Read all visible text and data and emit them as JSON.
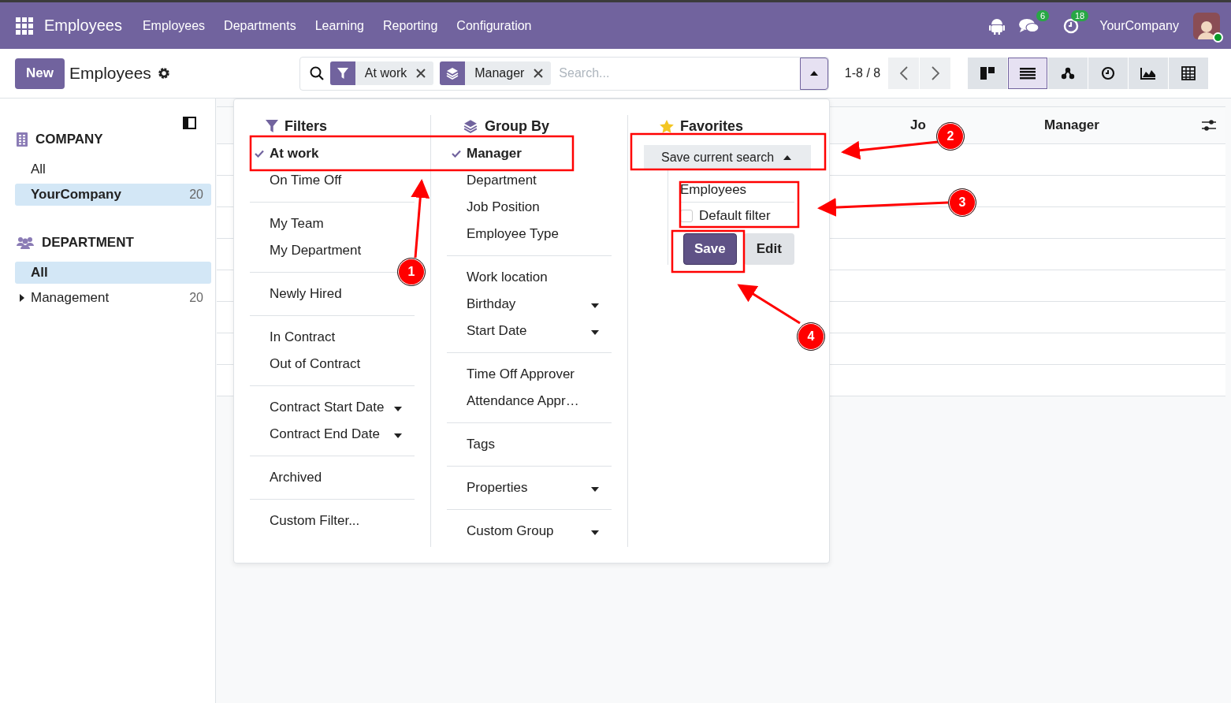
{
  "navbar": {
    "app_name": "Employees",
    "menu": [
      "Employees",
      "Departments",
      "Learning",
      "Reporting",
      "Configuration"
    ],
    "messages_count": "6",
    "activities_count": "18",
    "company": "YourCompany"
  },
  "control_panel": {
    "new_button": "New",
    "title": "Employees",
    "search": {
      "facets": [
        {
          "kind": "filter",
          "label": "At work"
        },
        {
          "kind": "group",
          "label": "Manager"
        }
      ],
      "placeholder": "Search...",
      "expanded": true
    },
    "pager": "1-8 / 8",
    "views": [
      {
        "kind": "kanban",
        "selected": false
      },
      {
        "kind": "list",
        "selected": true
      },
      {
        "kind": "hierarchy",
        "selected": false
      },
      {
        "kind": "activity",
        "selected": false
      },
      {
        "kind": "graph",
        "selected": false
      },
      {
        "kind": "pivot",
        "selected": false
      }
    ]
  },
  "sidebar": {
    "sections": [
      {
        "kind": "company",
        "title": "COMPANY",
        "items": [
          {
            "label": "All",
            "selected": false
          },
          {
            "label": "YourCompany",
            "count": "20",
            "selected": true
          }
        ]
      },
      {
        "kind": "department",
        "title": "DEPARTMENT",
        "items": [
          {
            "label": "All",
            "selected": true
          },
          {
            "label": "Management",
            "count": "20",
            "selected": false,
            "expandable": true
          }
        ]
      }
    ]
  },
  "table": {
    "columns": [
      "Jo",
      "Manager"
    ]
  },
  "dropdown": {
    "filters": {
      "title": "Filters",
      "groups": [
        [
          {
            "label": "At work",
            "checked": true,
            "kind": "toggle"
          },
          {
            "label": "On Time Off",
            "checked": false,
            "kind": "toggle"
          }
        ],
        [
          {
            "label": "My Team",
            "checked": false,
            "kind": "toggle"
          },
          {
            "label": "My Department",
            "checked": false,
            "kind": "toggle"
          }
        ],
        [
          {
            "label": "Newly Hired",
            "checked": false,
            "kind": "toggle"
          }
        ],
        [
          {
            "label": "In Contract",
            "checked": false,
            "kind": "toggle"
          },
          {
            "label": "Out of Contract",
            "checked": false,
            "kind": "toggle"
          }
        ],
        [
          {
            "label": "Contract Start Date",
            "checked": false,
            "kind": "menu"
          },
          {
            "label": "Contract End Date",
            "checked": false,
            "kind": "menu"
          }
        ],
        [
          {
            "label": "Archived",
            "checked": false,
            "kind": "toggle"
          }
        ],
        [
          {
            "label": "Custom Filter...",
            "checked": false,
            "kind": "toggle"
          }
        ]
      ]
    },
    "group_by": {
      "title": "Group By",
      "groups": [
        [
          {
            "label": "Manager",
            "checked": true,
            "kind": "toggle"
          },
          {
            "label": "Department",
            "checked": false,
            "kind": "toggle"
          },
          {
            "label": "Job Position",
            "checked": false,
            "kind": "toggle"
          },
          {
            "label": "Employee Type",
            "checked": false,
            "kind": "toggle"
          }
        ],
        [
          {
            "label": "Work location",
            "checked": false,
            "kind": "toggle"
          },
          {
            "label": "Birthday",
            "checked": false,
            "kind": "menu"
          },
          {
            "label": "Start Date",
            "checked": false,
            "kind": "menu"
          }
        ],
        [
          {
            "label": "Time Off Approver",
            "checked": false,
            "kind": "toggle"
          },
          {
            "label": "Attendance Appr…",
            "checked": false,
            "kind": "toggle"
          }
        ],
        [
          {
            "label": "Tags",
            "checked": false,
            "kind": "toggle"
          }
        ],
        [
          {
            "label": "Properties",
            "checked": false,
            "kind": "menu"
          }
        ],
        [
          {
            "label": "Custom Group",
            "checked": false,
            "kind": "menu"
          }
        ]
      ]
    },
    "favorites": {
      "title": "Favorites",
      "save_toggle": "Save current search",
      "expanded": true,
      "name_value": "Employees",
      "default_filter": {
        "label": "Default filter",
        "checked": false
      },
      "save_button": "Save",
      "edit_button": "Edit"
    }
  },
  "annotations": {
    "badges": [
      "1",
      "2",
      "3",
      "4"
    ]
  }
}
